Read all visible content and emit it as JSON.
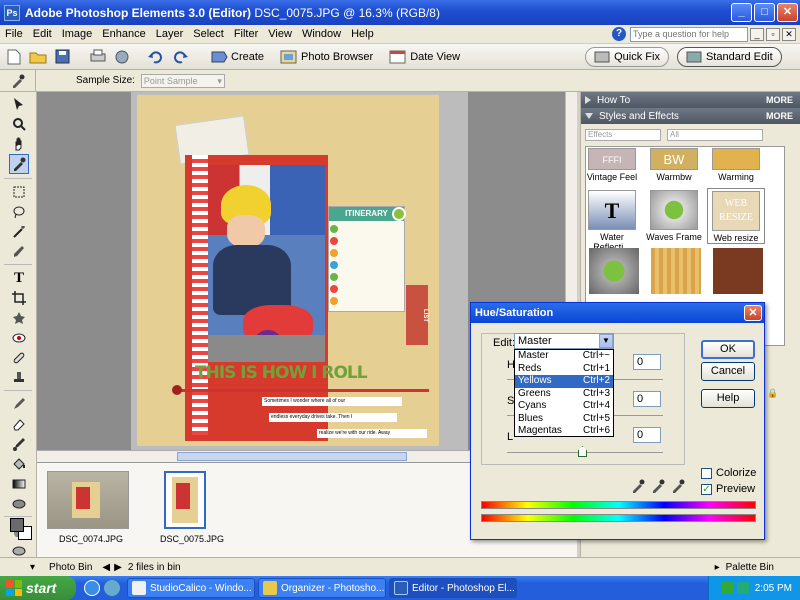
{
  "window": {
    "app_title": "Adobe Photoshop Elements 3.0 (Editor)",
    "doc_title": "DSC_0075.JPG @ 16.3% (RGB/8)",
    "minimize": "_",
    "maximize": "□",
    "close": "✕"
  },
  "menu": {
    "items": [
      "File",
      "Edit",
      "Image",
      "Enhance",
      "Layer",
      "Select",
      "Filter",
      "View",
      "Window",
      "Help"
    ],
    "help_placeholder": "Type a question for help"
  },
  "shortcuts": {
    "create": "Create",
    "photo_browser": "Photo Browser",
    "date_view": "Date View",
    "quick_fix": "Quick Fix",
    "standard_edit": "Standard Edit"
  },
  "options": {
    "sample_size_label": "Sample Size:",
    "sample_size_value": "Point Sample"
  },
  "photobin": {
    "thumbs": [
      "DSC_0074.JPG",
      "DSC_0075.JPG"
    ],
    "label": "Photo Bin",
    "count": "2 files in bin",
    "palette_bin": "Palette Bin"
  },
  "palette": {
    "how_to": "How To",
    "styles_effects": "Styles and Effects",
    "more": "MORE",
    "filter1": "Effects",
    "filter2": "All",
    "styles": [
      "Vintage Feel",
      "Warmbw",
      "Warming",
      "Water Reflecti...",
      "Waves Frame",
      "Web resize"
    ]
  },
  "canvas_text": {
    "itinerary": "ITINERARY",
    "headline": "THIS IS HOW I ROLL",
    "side_tab": "LIST",
    "journal1": "Sometimes I wonder where all of our",
    "journal2": "endless everyday drives take. Then I",
    "journal3": "realize we're with our ride. Away"
  },
  "dialog": {
    "title": "Hue/Saturation",
    "edit_label": "Edit:",
    "edit_value": "Master",
    "ok": "OK",
    "cancel": "Cancel",
    "help": "Help",
    "colorize": "Colorize",
    "preview": "Preview",
    "hue_value": "0",
    "sat_value": "0",
    "light_value": "0",
    "h_label": "H",
    "s_label": "S",
    "l_label": "L",
    "options": [
      {
        "name": "Master",
        "key": "Ctrl+~"
      },
      {
        "name": "Reds",
        "key": "Ctrl+1"
      },
      {
        "name": "Yellows",
        "key": "Ctrl+2"
      },
      {
        "name": "Greens",
        "key": "Ctrl+3"
      },
      {
        "name": "Cyans",
        "key": "Ctrl+4"
      },
      {
        "name": "Blues",
        "key": "Ctrl+5"
      },
      {
        "name": "Magentas",
        "key": "Ctrl+6"
      }
    ]
  },
  "taskbar": {
    "start": "start",
    "tasks": [
      "StudioCalico - Windo...",
      "Organizer - Photosho...",
      "Editor - Photoshop El..."
    ],
    "time": "2:05 PM"
  }
}
